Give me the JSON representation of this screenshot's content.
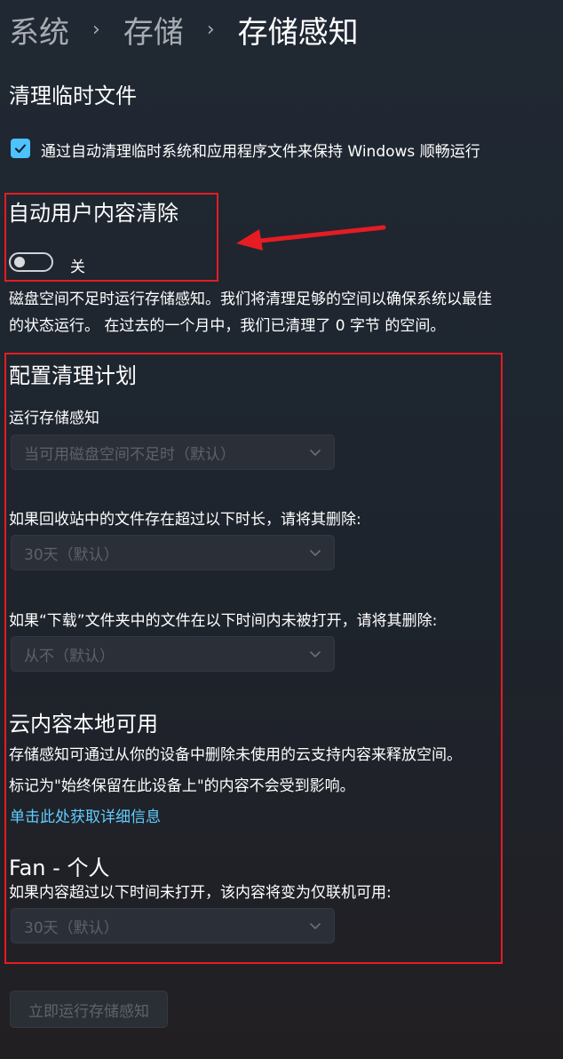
{
  "breadcrumb": {
    "items": [
      "系统",
      "存储"
    ],
    "separator": "›",
    "current": "存储感知"
  },
  "cleanup_temp": {
    "heading": "清理临时文件",
    "checkbox_label": "通过自动清理临时系统和应用程序文件来保持 Windows 顺畅运行",
    "checked": true
  },
  "auto_cleanup": {
    "heading": "自动用户内容清除",
    "toggle_label": "关",
    "toggle_on": false,
    "description_line1": "磁盘空间不足时运行存储感知。我们将清理足够的空间以确保系统以最佳",
    "description_line2": "的状态运行。 在过去的一个月中，我们已清理了 0 字节 的空间。"
  },
  "schedule": {
    "heading": "配置清理计划",
    "run_label": "运行存储感知",
    "run_value": "当可用磁盘空间不足时（默认）",
    "recycle_label": "如果回收站中的文件存在超过以下时长，请将其删除:",
    "recycle_value": "30天（默认）",
    "downloads_label": "如果“下载”文件夹中的文件在以下时间内未被打开，请将其删除:",
    "downloads_value": "从不（默认）"
  },
  "cloud": {
    "heading": "云内容本地可用",
    "line1": "存储感知可通过从你的设备中删除未使用的云支持内容来释放空间。",
    "line2": "标记为\"始终保留在此设备上\"的内容不会受到影响。",
    "link": "单击此处获取详细信息"
  },
  "onedrive": {
    "heading": "Fan - 个人",
    "label": "如果内容超过以下时间未打开，该内容将变为仅联机可用:",
    "value": "30天（默认）"
  },
  "run_now_button": "立即运行存储感知",
  "colors": {
    "accent": "#4cc2ff",
    "link": "#60cdff",
    "annotation_red": "#e51c23"
  }
}
